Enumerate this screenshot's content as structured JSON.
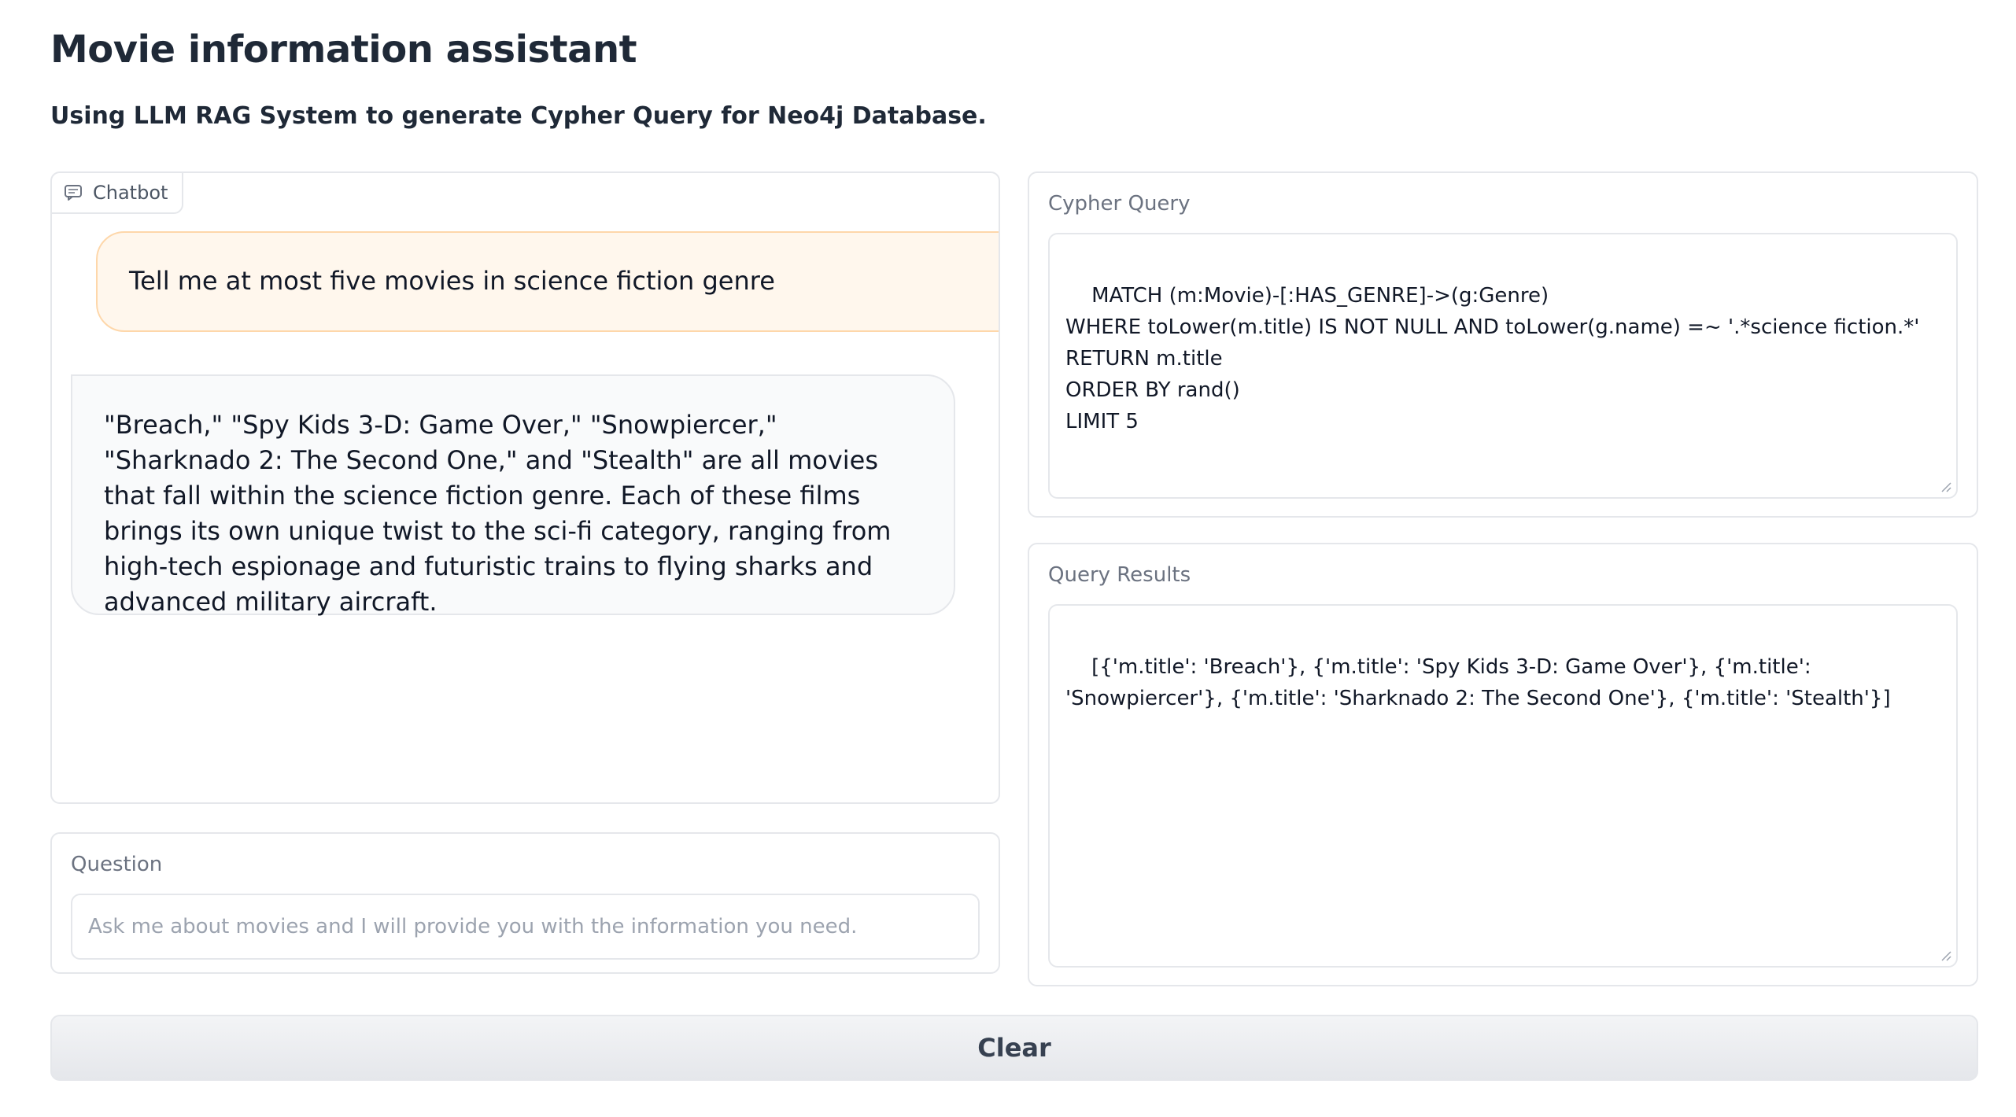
{
  "page": {
    "title": "Movie information assistant",
    "subtitle": "Using LLM RAG System to generate Cypher Query for Neo4j Database."
  },
  "chatbot": {
    "label": "Chatbot",
    "icon": "chat-icon",
    "messages": [
      {
        "role": "user",
        "text": "Tell me at most five movies in science fiction genre"
      },
      {
        "role": "bot",
        "text": "\"Breach,\" \"Spy Kids 3-D: Game Over,\" \"Snowpiercer,\" \"Sharknado 2: The Second One,\" and \"Stealth\" are all movies that fall within the science fiction genre. Each of these films brings its own unique twist to the sci-fi category, ranging from high-tech espionage and futuristic trains to flying sharks and advanced military aircraft."
      }
    ]
  },
  "question": {
    "label": "Question",
    "placeholder": "Ask me about movies and I will provide you with the information you need.",
    "value": ""
  },
  "cypher": {
    "label": "Cypher Query",
    "value": "MATCH (m:Movie)-[:HAS_GENRE]->(g:Genre)\nWHERE toLower(m.title) IS NOT NULL AND toLower(g.name) =~ '.*science fiction.*'\nRETURN m.title\nORDER BY rand()\nLIMIT 5"
  },
  "results": {
    "label": "Query Results",
    "value": "[{'m.title': 'Breach'}, {'m.title': 'Spy Kids 3-D: Game Over'}, {'m.title': 'Snowpiercer'}, {'m.title': 'Sharknado 2: The Second One'}, {'m.title': 'Stealth'}]"
  },
  "actions": {
    "clear_label": "Clear"
  },
  "colors": {
    "user_bubble_bg": "#fff7ed",
    "user_bubble_border": "#fed7aa",
    "bot_bubble_bg": "#f9fafb",
    "border": "#e5e7eb",
    "label_text": "#6b7280"
  }
}
